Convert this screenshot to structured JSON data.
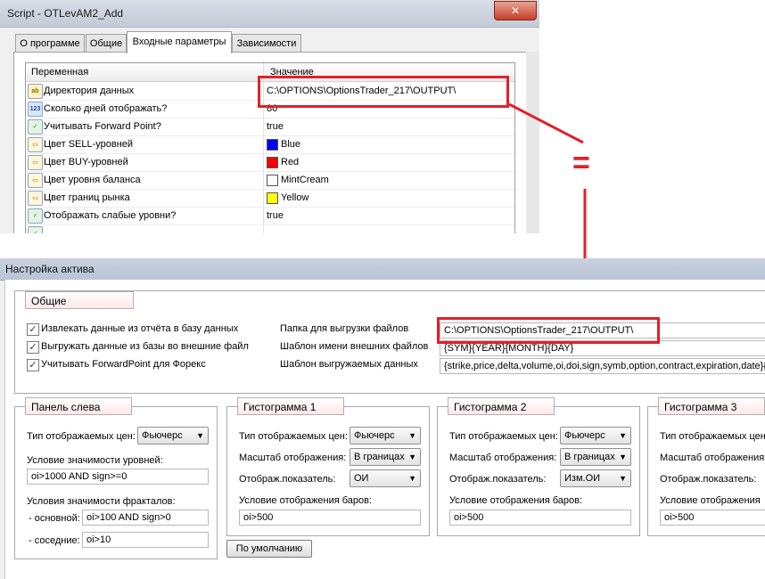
{
  "top_window": {
    "title": "Script - OTLevAM2_Add",
    "close_glyph": "x",
    "tabs": [
      {
        "label": "О программе",
        "active": false
      },
      {
        "label": "Общие",
        "active": false
      },
      {
        "label": "Входные параметры",
        "active": true
      },
      {
        "label": "Зависимости",
        "active": false
      }
    ],
    "grid": {
      "col_variable": "Переменная",
      "col_value": "Значение",
      "rows": [
        {
          "icon": "ab",
          "name": "Директория данных",
          "value": "C:\\OPTIONS\\OptionsTrader_217\\OUTPUT\\"
        },
        {
          "icon": "123",
          "name": "Сколько дней отображать?",
          "value": "80"
        },
        {
          "icon": "bool",
          "name": "Учитывать Forward Point?",
          "value": "true"
        },
        {
          "icon": "color",
          "name": "Цвет SELL-уровней",
          "value": "Blue",
          "swatch": "#0000ff"
        },
        {
          "icon": "color",
          "name": "Цвет BUY-уровней",
          "value": "Red",
          "swatch": "#ff0000"
        },
        {
          "icon": "color",
          "name": "Цвет уровня баланса",
          "value": "MintCream",
          "swatch": "#f5fffa"
        },
        {
          "icon": "color",
          "name": "Цвет границ рынка",
          "value": "Yellow",
          "swatch": "#ffff00"
        },
        {
          "icon": "bool",
          "name": "Отображать слабые уровни?",
          "value": "true"
        }
      ]
    }
  },
  "annotation": {
    "equals_sign": "="
  },
  "bottom_window": {
    "title": "Настройка актива",
    "general": {
      "title": "Общие",
      "checkboxes": [
        {
          "label": "Извлекать данные из отчёта в базу данных",
          "checked": true
        },
        {
          "label": "Выгружать данные из базы во внешние файл",
          "checked": true
        },
        {
          "label": "Учитывать ForwardPoint для Форекс",
          "checked": true
        }
      ],
      "export_folder_label": "Папка для выгрузки файлов",
      "export_folder_value": "C:\\OPTIONS\\OptionsTrader_217\\OUTPUT\\",
      "file_template_label": "Шаблон имени внешних файлов",
      "file_template_value": "{SYM}{YEAR}{MONTH}{DAY}",
      "data_template_label": "Шаблон выгружаемых данных",
      "data_template_value": "{strike,price,delta,volume,oi,doi,sign,symb,option,contract,expiration,date}{oi>"
    },
    "left_panel": {
      "title": "Панель слева",
      "price_type_label": "Тип отображаемых цен:",
      "price_type_value": "Фьючерс",
      "level_cond_label": "Условие значимости уровней:",
      "level_cond_value": "oi>1000 AND sign>=0",
      "fractal_cond_label": "Условия значимости фракталов:",
      "main_label": "- основной:",
      "main_value": "oi>100 AND sign>0",
      "neighbor_label": "- соседние:",
      "neighbor_value": "oi>10"
    },
    "histograms": [
      {
        "title": "Гистограмма 1",
        "price_type_label": "Тип отображаемых цен:",
        "price_type_value": "Фьючерс",
        "scale_label": "Масштаб отображения:",
        "scale_value": "В границах",
        "indicator_label": "Отображ.показатель:",
        "indicator_value": "ОИ",
        "bar_cond_label": "Условие отображения баров:",
        "bar_cond_value": "oi>500"
      },
      {
        "title": "Гистограмма 2",
        "price_type_label": "Тип отображаемых цен:",
        "price_type_value": "Фьючерс",
        "scale_label": "Масштаб отображения:",
        "scale_value": "В границах",
        "indicator_label": "Отображ.показатель:",
        "indicator_value": "Изм.ОИ",
        "bar_cond_label": "Условие отображения баров:",
        "bar_cond_value": "oi>500"
      },
      {
        "title": "Гистограмма 3",
        "price_type_label": "Тип отображаемых цен:",
        "scale_label": "Масштаб отображения:",
        "indicator_label": "Отображ.показатель:",
        "bar_cond_label": "Условие отображения",
        "bar_cond_value": "oi>500"
      }
    ],
    "default_button": "По умолчанию"
  }
}
